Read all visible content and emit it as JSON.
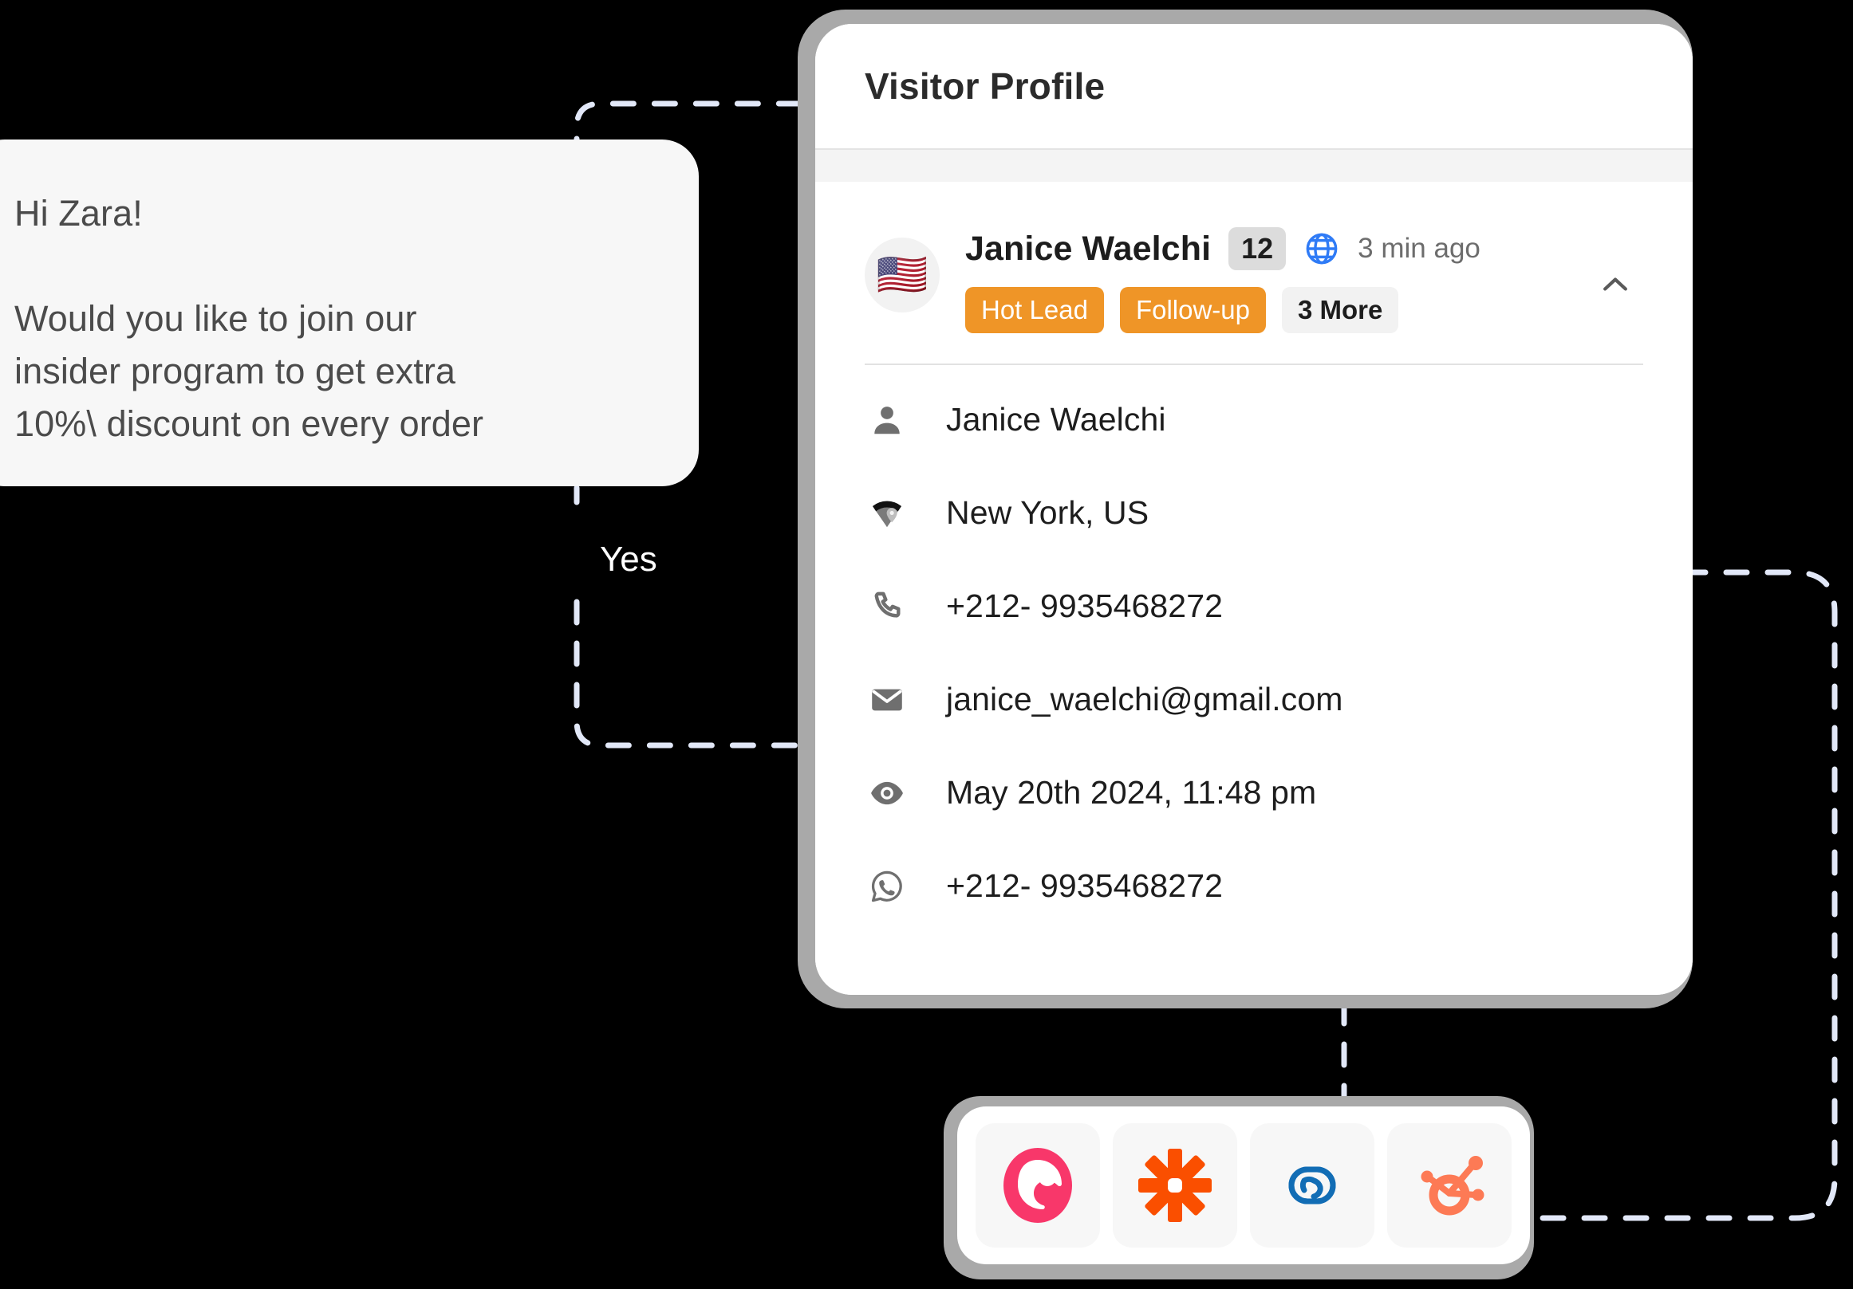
{
  "chat": {
    "greeting": "Hi Zara!",
    "message": "Would you like to join our\ninsider program to get extra\n10%\\ discount on every order",
    "branch_label": "Yes"
  },
  "profile": {
    "title": "Visitor Profile",
    "avatar_flag": "🇺🇸",
    "visitor_name": "Janice Waelchi",
    "visit_count": "12",
    "last_seen": "3 min ago",
    "globe_icon": "globe-icon",
    "collapse_icon": "chevron-up-icon",
    "tags": [
      {
        "label": "Hot Lead",
        "style": "accent"
      },
      {
        "label": "Follow-up",
        "style": "accent"
      },
      {
        "label": "3 More",
        "style": "muted"
      }
    ],
    "details": [
      {
        "icon": "person-icon",
        "value": "Janice Waelchi"
      },
      {
        "icon": "location-icon",
        "value": "New York, US"
      },
      {
        "icon": "phone-icon",
        "value": "+212- 9935468272"
      },
      {
        "icon": "email-icon",
        "value": "janice_waelchi@gmail.com"
      },
      {
        "icon": "eye-icon",
        "value": "May 20th 2024, 11:48 pm"
      },
      {
        "icon": "whatsapp-icon",
        "value": "+212- 9935468272"
      }
    ]
  },
  "integrations": [
    {
      "name": "copper-icon",
      "color": "#f8376a"
    },
    {
      "name": "zapier-icon",
      "color": "#fa4f00"
    },
    {
      "name": "zoho-icon",
      "color": "#126db5"
    },
    {
      "name": "hubspot-icon",
      "color": "#fd7a55"
    }
  ],
  "colors": {
    "background": "#000000",
    "card": "#ffffff",
    "frame": "#a9a9a9",
    "bubble": "#f7f7f7",
    "tag_accent": "#ef9527",
    "tag_muted": "#f2f2f2",
    "connector": "#e2e8f8",
    "globe_blue": "#2f7bf6"
  }
}
